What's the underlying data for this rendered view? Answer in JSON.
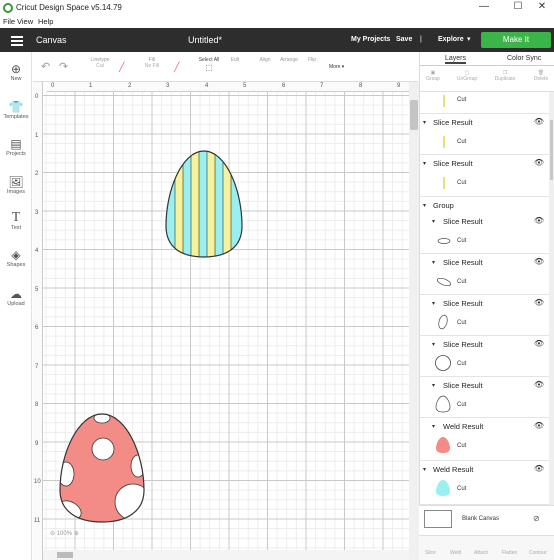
{
  "window": {
    "title": "Cricut Design Space  v5.14.79",
    "minimize": "—",
    "maximize": "☐",
    "close": "✕"
  },
  "menu": [
    "File",
    "View",
    "Help"
  ],
  "header": {
    "canvas_label": "Canvas",
    "doc_title": "Untitled*",
    "my_projects": "My Projects",
    "save": "Save",
    "divider": "|",
    "explore": "Explore",
    "make_it": "Make It"
  },
  "sidebar": [
    {
      "label": "New",
      "icon": "plus-circle-icon"
    },
    {
      "label": "Templates",
      "icon": "shirt-icon"
    },
    {
      "label": "Projects",
      "icon": "projects-icon"
    },
    {
      "label": "Images",
      "icon": "image-icon"
    },
    {
      "label": "Text",
      "icon": "text-icon"
    },
    {
      "label": "Shapes",
      "icon": "shapes-icon"
    },
    {
      "label": "Upload",
      "icon": "upload-cloud-icon"
    }
  ],
  "toolbar": {
    "linetype_label": "Linetype",
    "linetype_value": "Cut",
    "fill_label": "Fill",
    "fill_value": "No Fill",
    "select_all": "Select All",
    "edit": "Edit",
    "align": "Align",
    "arrange": "Arrange",
    "flip": "Flip",
    "more": "More"
  },
  "ruler": {
    "h": [
      "0",
      "1",
      "2",
      "3",
      "4",
      "5",
      "6",
      "7",
      "8",
      "9"
    ],
    "v": [
      "0",
      "1",
      "2",
      "3",
      "4",
      "5",
      "6",
      "7",
      "8",
      "9",
      "10",
      "11"
    ]
  },
  "canvas": {
    "zoom": "100%"
  },
  "panel": {
    "tabs": [
      "Layers",
      "Color Sync"
    ],
    "tools": [
      "Group",
      "UnGroup",
      "Duplicate",
      "Delete"
    ],
    "layers": [
      {
        "title": "",
        "cut": "Cut",
        "thumb": "yellow-stripe"
      },
      {
        "title": "Slice Result",
        "cut": "Cut",
        "thumb": "yellow-stripe"
      },
      {
        "title": "Slice Result",
        "cut": "Cut",
        "thumb": "yellow-stripe"
      },
      {
        "title": "Group"
      },
      {
        "title": "Slice Result",
        "cut": "Cut",
        "thumb": "ellipse"
      },
      {
        "title": "Slice Result",
        "cut": "Cut",
        "thumb": "ellipse-tilted"
      },
      {
        "title": "Slice Result",
        "cut": "Cut",
        "thumb": "oval"
      },
      {
        "title": "Slice Result",
        "cut": "Cut",
        "thumb": "circle"
      },
      {
        "title": "Slice Result",
        "cut": "Cut",
        "thumb": "egg-outline"
      },
      {
        "title": "Weld Result",
        "cut": "Cut",
        "thumb": "pink-egg"
      },
      {
        "title": "Weld Result",
        "cut": "Cut",
        "thumb": "cyan-egg"
      }
    ],
    "blank_canvas": "Blank Canvas",
    "bottom_tools": [
      "Slice",
      "Weld",
      "Attach",
      "Flatten",
      "Contour"
    ]
  },
  "colors": {
    "header": "#2d2d2d",
    "make_it": "#3bb54a",
    "egg_cyan": "#9aeff0",
    "egg_yellow": "#f6f29c",
    "egg_pink": "#f38b86"
  }
}
